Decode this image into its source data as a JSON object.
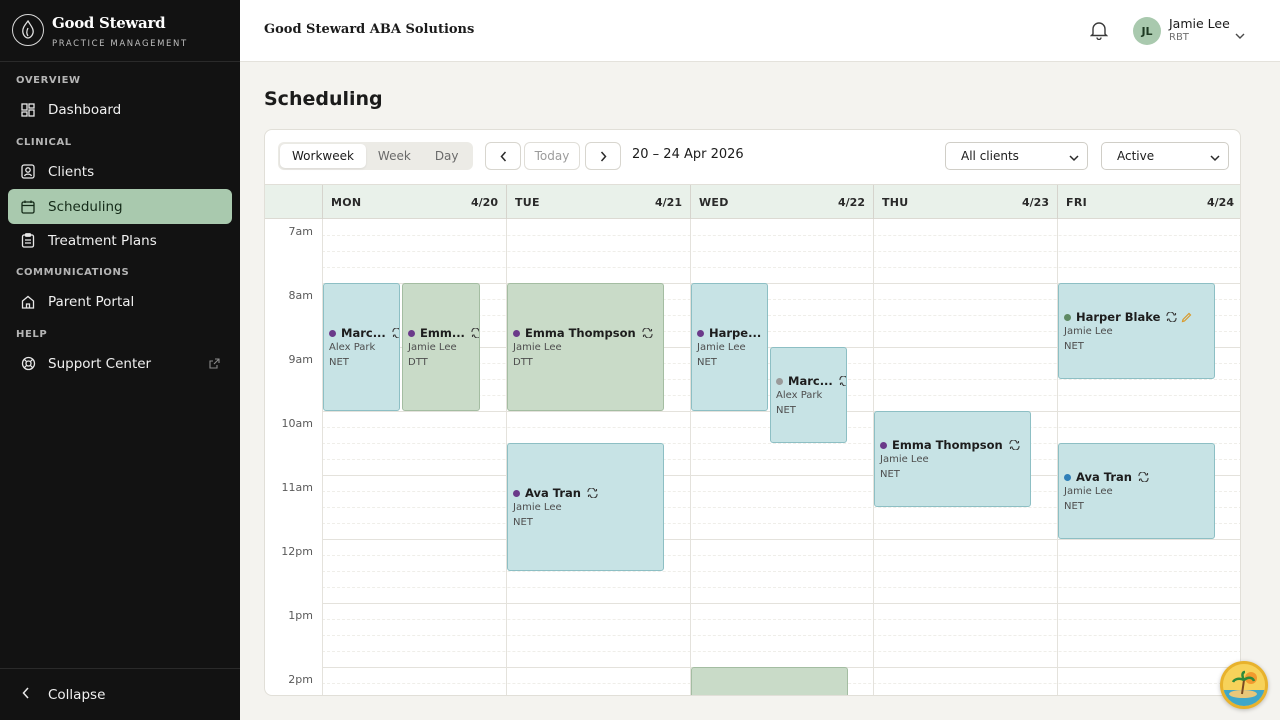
{
  "brand": {
    "name": "Good Steward",
    "subtitle": "PRACTICE MANAGEMENT"
  },
  "sidebar": {
    "sections": [
      {
        "label": "OVERVIEW"
      },
      {
        "label": "CLINICAL"
      },
      {
        "label": "COMMUNICATIONS"
      },
      {
        "label": "HELP"
      }
    ],
    "items": [
      {
        "label": "Dashboard",
        "icon": "grid-icon"
      },
      {
        "label": "Clients",
        "icon": "user-badge-icon"
      },
      {
        "label": "Scheduling",
        "icon": "calendar-icon",
        "active": true
      },
      {
        "label": "Treatment Plans",
        "icon": "clipboard-icon"
      },
      {
        "label": "Parent Portal",
        "icon": "house-icon"
      },
      {
        "label": "Support Center",
        "icon": "lifebuoy-icon"
      }
    ],
    "collapse_label": "Collapse"
  },
  "topbar": {
    "org_name": "Good Steward ABA Solutions",
    "user": {
      "initials": "JL",
      "name": "Jamie Lee",
      "role": "RBT"
    }
  },
  "page": {
    "title": "Scheduling"
  },
  "toolbar": {
    "views": [
      "Workweek",
      "Week",
      "Day"
    ],
    "active_view": "Workweek",
    "today_label": "Today",
    "date_range": "20 – 24 Apr 2026",
    "client_filter": "All clients",
    "status_filter": "Active"
  },
  "calendar": {
    "days": [
      {
        "name": "MON",
        "date": "4/20"
      },
      {
        "name": "TUE",
        "date": "4/21"
      },
      {
        "name": "WED",
        "date": "4/22"
      },
      {
        "name": "THU",
        "date": "4/23"
      },
      {
        "name": "FRI",
        "date": "4/24"
      }
    ],
    "hours": [
      "7am",
      "8am",
      "9am",
      "10am",
      "11am",
      "12pm",
      "1pm",
      "2pm"
    ],
    "events": [
      {
        "title": "Marc...",
        "staff": "Alex Park",
        "type": "NET"
      },
      {
        "title": "Emm...",
        "staff": "Jamie Lee",
        "type": "DTT"
      },
      {
        "title": "Emma Thompson",
        "staff": "Jamie Lee",
        "type": "DTT"
      },
      {
        "title": "Ava Tran",
        "staff": "Jamie Lee",
        "type": "NET"
      },
      {
        "title": "Harpe...",
        "staff": "Jamie Lee",
        "type": "NET"
      },
      {
        "title": "Marc...",
        "staff": "Alex Park",
        "type": "NET"
      },
      {
        "title": "Emma Thompson",
        "staff": "Jamie Lee",
        "type": "NET"
      },
      {
        "title": "Harper Blake",
        "staff": "Jamie Lee",
        "type": "NET"
      },
      {
        "title": "Ava Tran",
        "staff": "Jamie Lee",
        "type": "NET"
      }
    ],
    "colors": {
      "net": "#c7e3e5",
      "dtt": "#c9dbc8",
      "dot_purple": "#6b3a8a",
      "dot_gray": "#9a9a9a",
      "dot_green": "#5f8a63",
      "dot_blue": "#2f7fb8"
    }
  }
}
